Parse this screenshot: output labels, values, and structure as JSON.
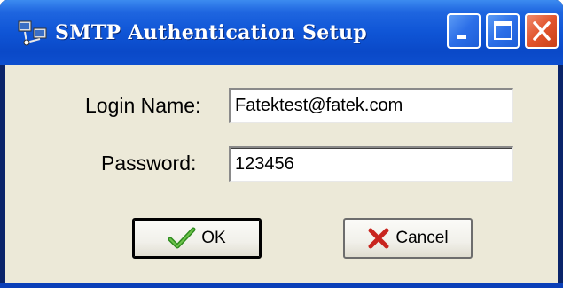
{
  "window": {
    "title": "SMTP Authentication Setup",
    "controls": {
      "minimize_icon": "minimize-icon",
      "maximize_icon": "maximize-icon",
      "close_icon": "close-icon"
    },
    "app_icon": "network-computers-icon"
  },
  "form": {
    "login": {
      "label": "Login Name:",
      "value": "Fatektest@fatek.com"
    },
    "password": {
      "label": "Password:",
      "value": "123456"
    }
  },
  "buttons": {
    "ok": {
      "label": "OK",
      "icon": "checkmark-icon"
    },
    "cancel": {
      "label": "Cancel",
      "icon": "x-mark-icon"
    }
  },
  "colors": {
    "titlebar": "#0f55d6",
    "client_background": "#ece9d8",
    "close_button": "#e2542c",
    "check_green": "#2e8b1e",
    "cancel_red": "#c8241e"
  }
}
